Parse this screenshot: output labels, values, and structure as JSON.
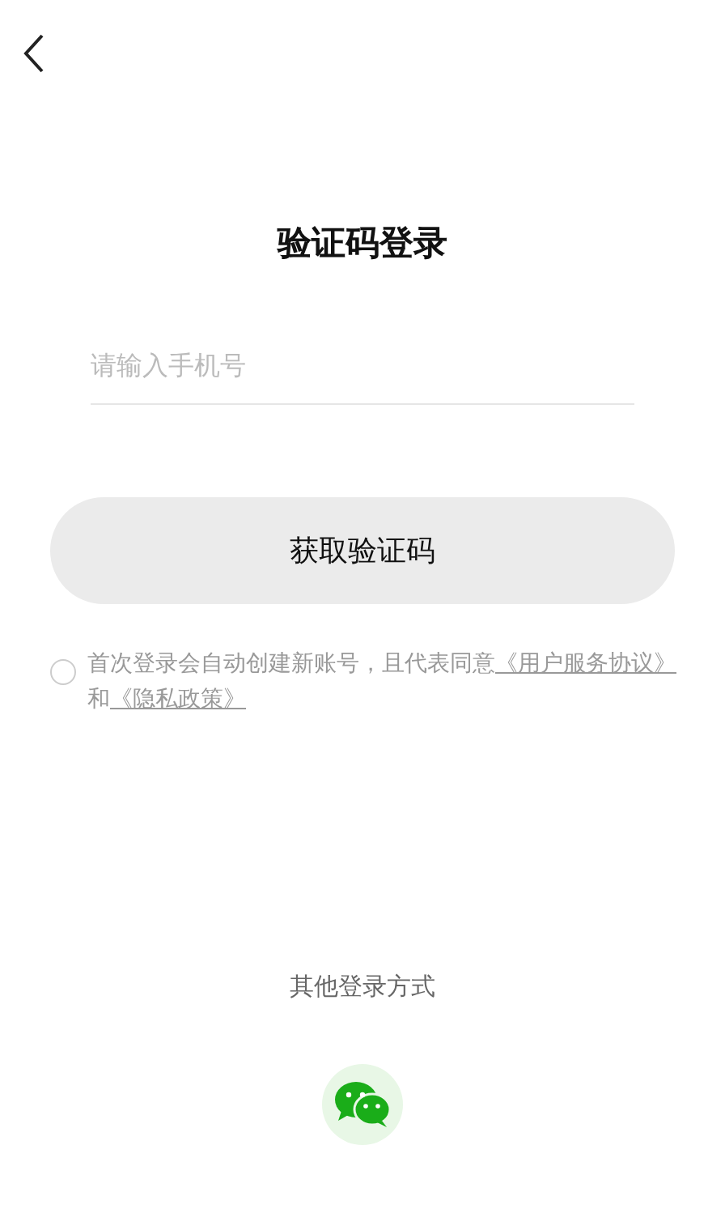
{
  "title": "验证码登录",
  "phone_field": {
    "placeholder": "请输入手机号"
  },
  "submit_button": {
    "label": "获取验证码"
  },
  "agreement": {
    "checked": false,
    "parts": [
      {
        "kind": "text",
        "text": "首次登录会自动创建新账号，且代表同意"
      },
      {
        "kind": "link",
        "text": "《用户服务协议》"
      },
      {
        "kind": "text",
        "text": "和"
      },
      {
        "kind": "link",
        "text": "《隐私政策》"
      }
    ]
  },
  "other_login": {
    "label": "其他登录方式"
  }
}
